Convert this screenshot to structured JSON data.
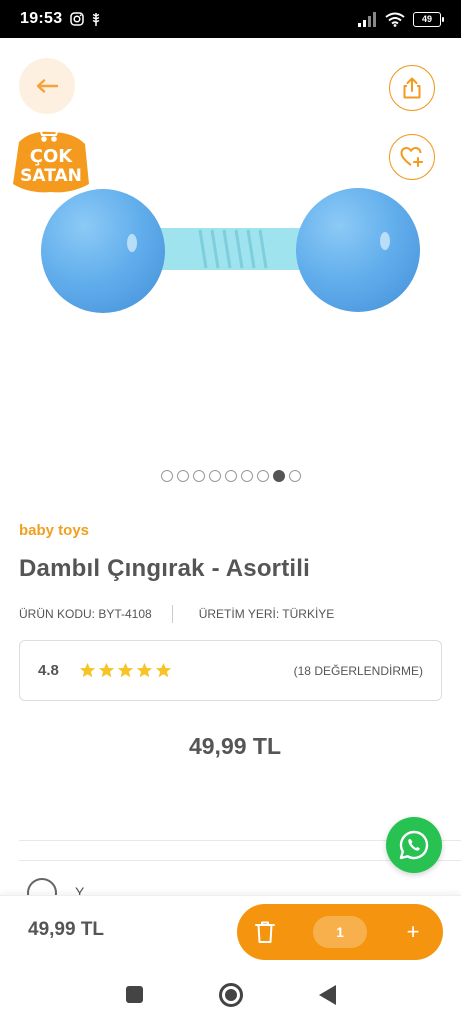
{
  "status_bar": {
    "time": "19:53",
    "battery": "49"
  },
  "badge": {
    "line1": "ÇOK",
    "line2": "SATAN"
  },
  "carousel": {
    "total": 9,
    "active_index": 7
  },
  "product": {
    "brand": "baby toys",
    "title": "Dambıl Çıngırak - Asortili",
    "code": "ÜRÜN KODU: BYT-4108",
    "origin": "ÜRETİM YERİ: TÜRKİYE",
    "rating": "4.8",
    "rating_stars": 5,
    "reviews": "(18 DEĞERLENDİRME)",
    "price": "49,99 TL"
  },
  "section": {
    "label": "Y"
  },
  "bottom_bar": {
    "price": "49,99 TL",
    "quantity": "1",
    "plus": "+"
  },
  "colors": {
    "accent": "#f5950f",
    "brand_text": "#f0a020",
    "whatsapp": "#27c252",
    "toy_blue": "#6ab4ee",
    "toy_handle": "#9ee3ee",
    "badge_orange": "#f39a1f"
  }
}
